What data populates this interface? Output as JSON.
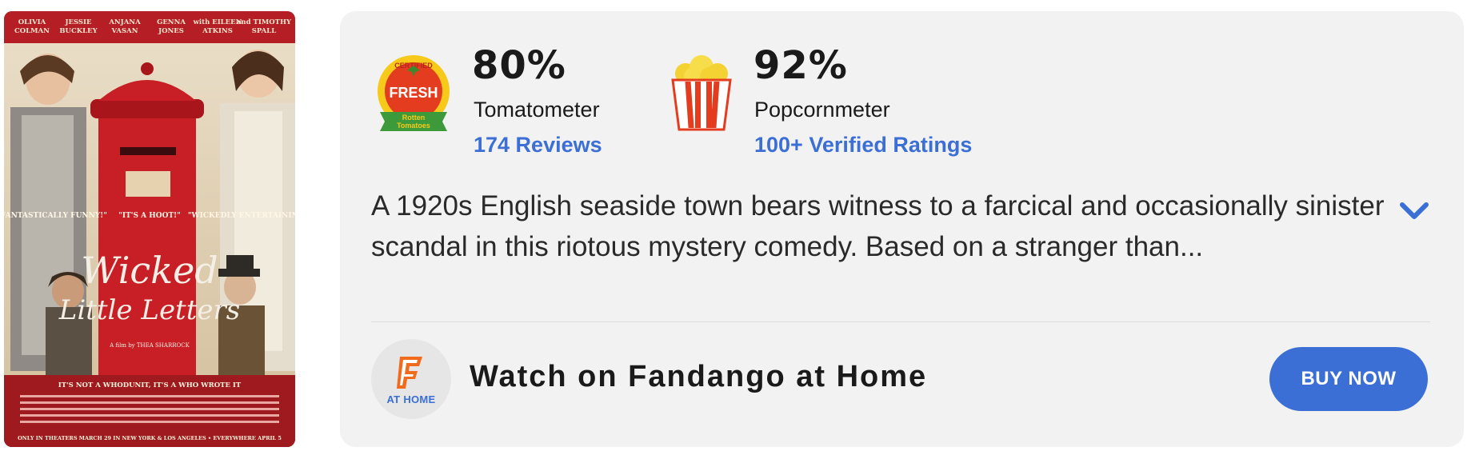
{
  "poster": {
    "alt": "Wicked Little Letters",
    "cast": [
      "OLIVIA",
      "COLMAN",
      "JESSIE",
      "BUCKLEY",
      "ANJANA",
      "VASAN",
      "GENNA",
      "JONES",
      "with EILEEN",
      "ATKINS",
      "and TIMOTHY",
      "SPALL"
    ],
    "quote_left": "\"FANTASTICALLY FUNNY!\"",
    "quote_center": "\"IT'S A HOOT!\"",
    "quote_right": "\"WICKEDLY ENTERTAINING\"",
    "title_line1": "Wicked",
    "title_line2": "Little Letters",
    "director": "A film by THEA SHARROCK",
    "tagline": "IT'S NOT A WHODUNIT, IT'S A WHO WROTE IT",
    "release": "ONLY IN THEATERS MARCH 29 IN NEW YORK & LOS ANGELES • EVERYWHERE APRIL 5"
  },
  "tomatometer": {
    "icon": "certified-fresh-icon",
    "badge_top": "CERTIFIED",
    "badge_mid": "FRESH",
    "badge_bottom1": "Rotten",
    "badge_bottom2": "Tomatoes",
    "percent": "80%",
    "label": "Tomatometer",
    "reviews": "174 Reviews"
  },
  "popcornmeter": {
    "icon": "popcorn-bucket-icon",
    "percent": "92%",
    "label": "Popcornmeter",
    "ratings": "100+ Verified Ratings"
  },
  "synopsis": "A 1920s English seaside town bears witness to a farcical and occasionally sinister scandal in this riotous mystery comedy. Based on a stranger than...",
  "fandango": {
    "logo_letter": "F",
    "logo_caption": "AT HOME",
    "watch_text": "Watch on Fandango at Home",
    "buy_label": "BUY NOW"
  },
  "colors": {
    "accent": "#3b6fd6",
    "card_bg": "#f2f2f2",
    "fresh_red": "#e43c1f",
    "fresh_gold": "#f7c91a",
    "fandango_orange": "#f26a1b"
  }
}
